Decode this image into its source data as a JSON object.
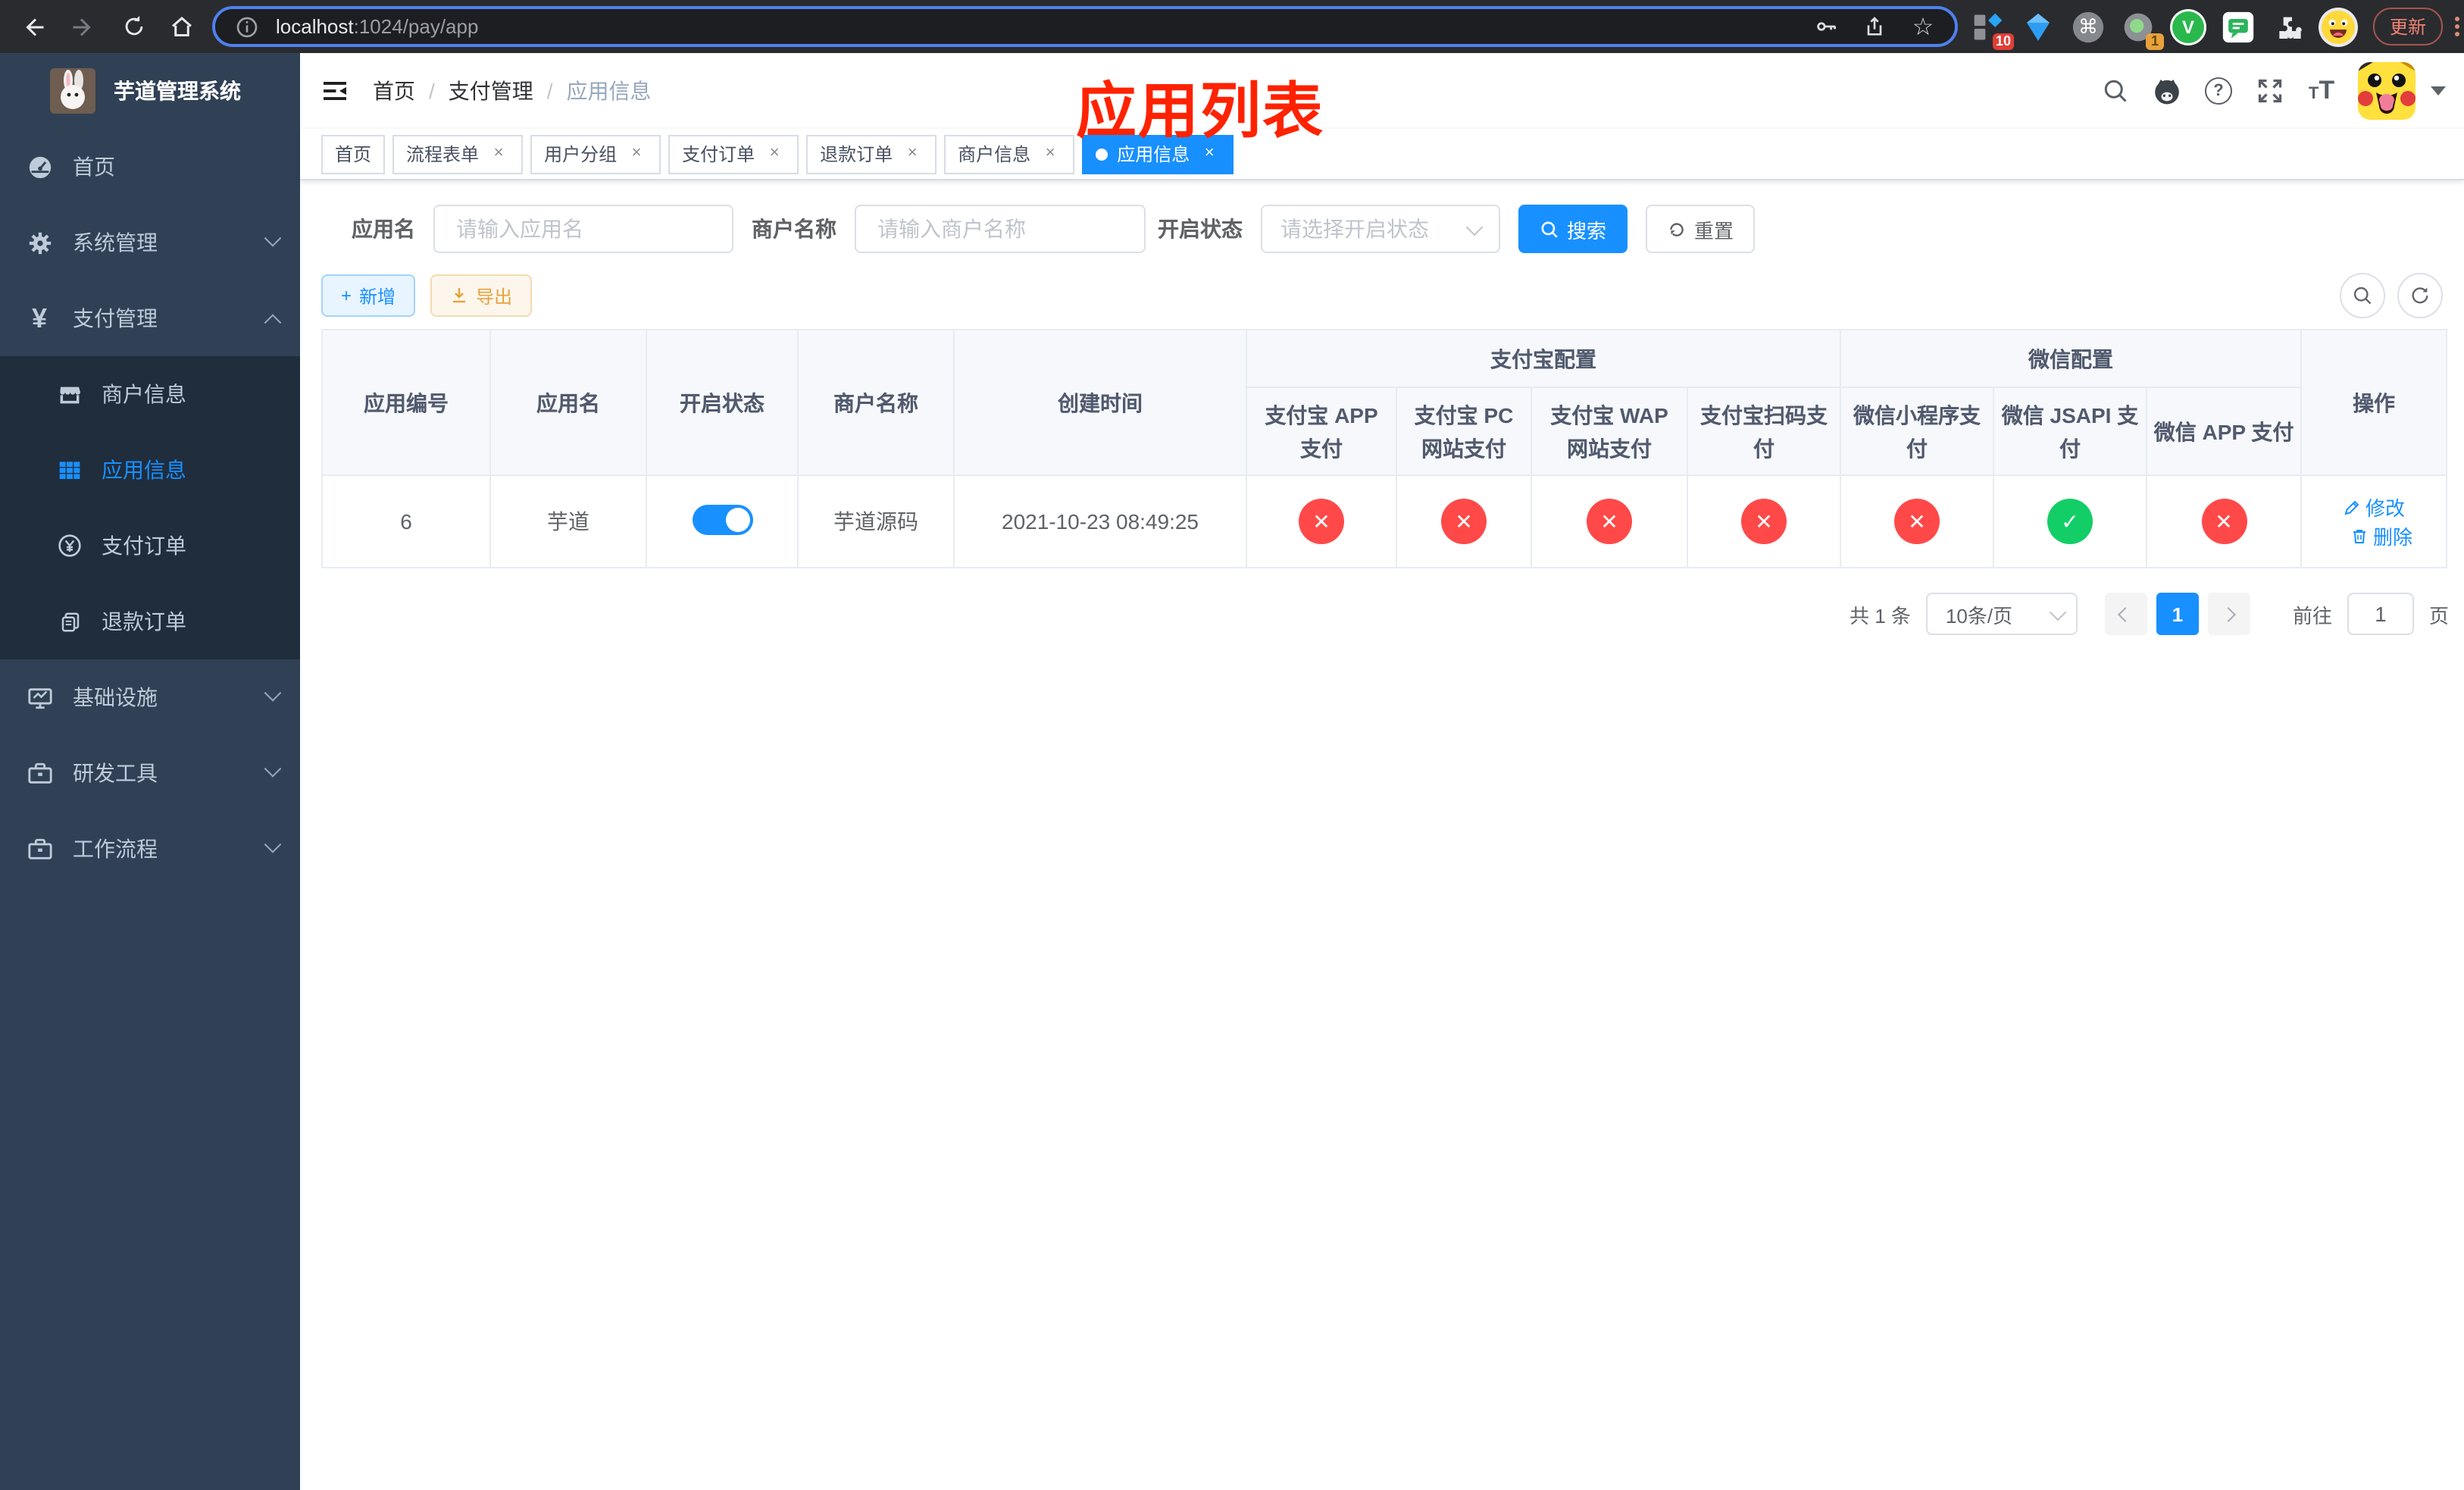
{
  "browser": {
    "url_host": "localhost",
    "url_path": ":1024/pay/app",
    "ext_badge_a": "10",
    "ext_badge_b": "1",
    "update_label": "更新"
  },
  "glyphs": {
    "yen": "¥",
    "star": "☆",
    "cmd": "⌘",
    "v": "V",
    "question": "?",
    "plus": "+",
    "font_small": "T",
    "font_large": "T"
  },
  "sidebar": {
    "title": "芋道管理系统",
    "items": [
      {
        "label": "首页"
      },
      {
        "label": "系统管理"
      },
      {
        "label": "支付管理"
      },
      {
        "label": "商户信息"
      },
      {
        "label": "应用信息"
      },
      {
        "label": "支付订单"
      },
      {
        "label": "退款订单"
      },
      {
        "label": "基础设施"
      },
      {
        "label": "研发工具"
      },
      {
        "label": "工作流程"
      }
    ]
  },
  "navbar": {
    "breadcrumb": [
      "首页",
      "支付管理",
      "应用信息"
    ],
    "separator": "/",
    "overlay_title": "应用列表"
  },
  "tags": [
    {
      "label": "首页"
    },
    {
      "label": "流程表单"
    },
    {
      "label": "用户分组"
    },
    {
      "label": "支付订单"
    },
    {
      "label": "退款订单"
    },
    {
      "label": "商户信息"
    },
    {
      "label": "应用信息"
    }
  ],
  "filters": {
    "app_name_label": "应用名",
    "app_name_placeholder": "请输入应用名",
    "merchant_label": "商户名称",
    "merchant_placeholder": "请输入商户名称",
    "status_label": "开启状态",
    "status_placeholder": "请选择开启状态",
    "search_label": "搜索",
    "reset_label": "重置"
  },
  "toolbar": {
    "add_label": "新增",
    "export_label": "导出"
  },
  "table": {
    "col_id": "应用编号",
    "col_name": "应用名",
    "col_status": "开启状态",
    "col_merchant": "商户名称",
    "col_created": "创建时间",
    "group_alipay": "支付宝配置",
    "group_wechat": "微信配置",
    "sub_columns": [
      "支付宝 APP 支付",
      "支付宝 PC 网站支付",
      "支付宝 WAP 网站支付",
      "支付宝扫码支付",
      "微信小程序支付",
      "微信 JSAPI 支付",
      "微信 APP 支付"
    ],
    "col_actions": "操作",
    "row": {
      "id": "6",
      "name": "芋道",
      "enabled": true,
      "merchant": "芋道源码",
      "created": "2021-10-23 08:49:25",
      "configs": [
        "off",
        "off",
        "off",
        "off",
        "off",
        "on",
        "off"
      ],
      "edit_label": "修改",
      "delete_label": "删除"
    }
  },
  "pagination": {
    "total": "共 1 条",
    "page_size": "10条/页",
    "page": "1",
    "goto_label": "前往",
    "goto_value": "1",
    "page_unit": "页"
  }
}
